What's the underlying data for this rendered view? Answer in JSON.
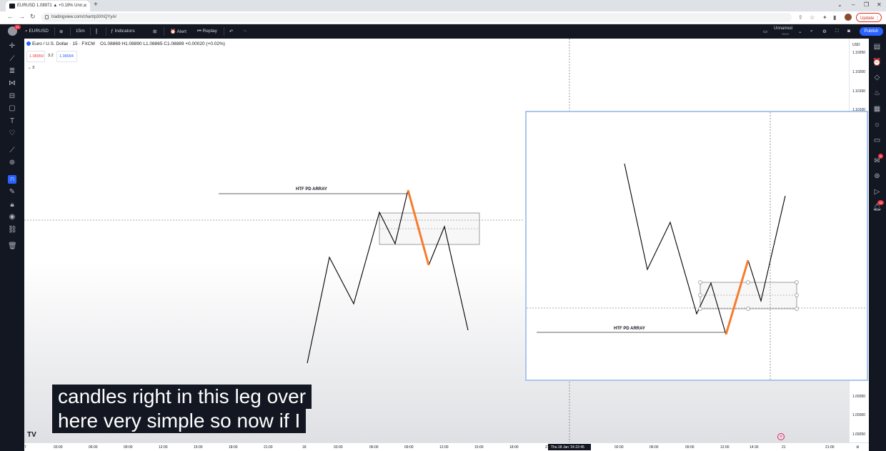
{
  "browser": {
    "tab_title": "EURUSD 1.08971 ▲ +0.19% Unn…",
    "url": "tradingview.com/chart/p3XhQYyA/",
    "update_label": "Update"
  },
  "tv_toolbar": {
    "avatar_badge": "11",
    "symbol": "EURUSD",
    "interval": "15m",
    "indicators": "Indicators",
    "alert": "Alert",
    "replay": "Replay",
    "layout_name": "Unnamed",
    "layout_sub": "Save",
    "publish": "Publish"
  },
  "legend": {
    "symbol_name": "Euro / U.S. Dollar · 15 · FXCM",
    "ohlc": "O1.08869 H1.08890 L1.08865 C1.08889 +0.00020 (+0.02%)",
    "sell_price": "1.08959",
    "spread": "3.2",
    "buy_price": "1.08994",
    "collapse_count": "3"
  },
  "price_axis": {
    "currency": "USD",
    "labels": [
      "1.10250",
      "1.10200",
      "1.10150",
      "1.10100",
      "1.09350",
      "1.09300",
      "1.09250"
    ]
  },
  "time_axis": {
    "labels": [
      "7",
      "03:00",
      "06:00",
      "09:00",
      "12:00",
      "15:00",
      "18:00",
      "21:00",
      "18",
      "03:00",
      "06:00",
      "09:00",
      "12:00",
      "15:00",
      "18:00",
      "21",
      "02:00",
      "06:00",
      "09:00",
      "12:00",
      "14:30",
      "21",
      "21:00"
    ],
    "cursor_date": "Thu 18 Jan '24   22:45"
  },
  "drawings": {
    "main_label": "HTF PD ARRAY",
    "inset_label": "HTF PD ARRAY"
  },
  "right_badges": {
    "ideas": "8",
    "notifications": "10"
  },
  "subtitle": {
    "line1": "candles right in this leg over",
    "line2": "here very simple so now if I"
  },
  "colors": {
    "accent": "#2962ff",
    "leg_highlight": "#f57c2c",
    "toolbar_bg": "#131722"
  }
}
